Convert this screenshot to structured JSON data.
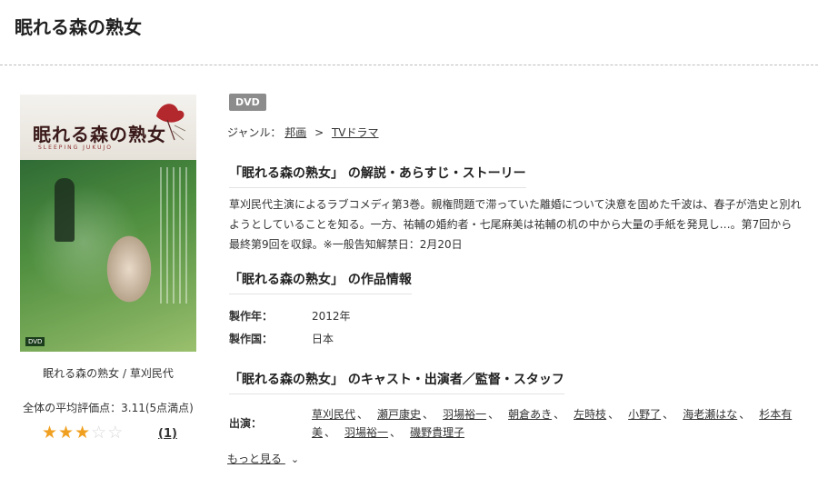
{
  "page": {
    "title": "眠れる森の熟女"
  },
  "cover": {
    "title": "眠れる森の熟女",
    "subtitle": "SLEEPING JUKUJO",
    "label": "DVD"
  },
  "caption": "眠れる森の熟女 / 草刈民代",
  "rating": {
    "text": "全体の平均評価点：3.11(5点満点)",
    "stars_filled": 3,
    "stars_total": 5,
    "review_count": "(1)",
    "colors": {
      "on": "#f0a020",
      "off": "#d8d8d8"
    }
  },
  "badge": "DVD",
  "genre": {
    "label": "ジャンル：",
    "items": [
      "邦画",
      "TVドラマ"
    ],
    "separator": ">"
  },
  "synopsis": {
    "heading": "「眠れる森の熟女」 の解説・あらすじ・ストーリー",
    "body": "草刈民代主演によるラブコメディ第3巻。親権問題で滞っていた離婚について決意を固めた千波は、春子が浩史と別れようとしていることを知る。一方、祐輔の婚約者・七尾麻美は祐輔の机の中から大量の手紙を発見し…。第7回から最終第9回を収録。※一般告知解禁日：2月20日"
  },
  "info": {
    "heading": "「眠れる森の熟女」 の作品情報",
    "rows": [
      {
        "label": "製作年：",
        "value": "2012年"
      },
      {
        "label": "製作国：",
        "value": "日本"
      }
    ]
  },
  "cast": {
    "heading": "「眠れる森の熟女」 のキャスト・出演者／監督・スタッフ",
    "label": "出演：",
    "names": [
      "草刈民代",
      "瀬戸康史",
      "羽場裕一",
      "朝倉あき",
      "左時枝",
      "小野了",
      "海老瀬はな",
      "杉本有美",
      "羽場裕一",
      "磯野貴理子"
    ],
    "separator": "、"
  },
  "more": {
    "label": "もっと見る",
    "icon": "chevron-down-icon"
  }
}
